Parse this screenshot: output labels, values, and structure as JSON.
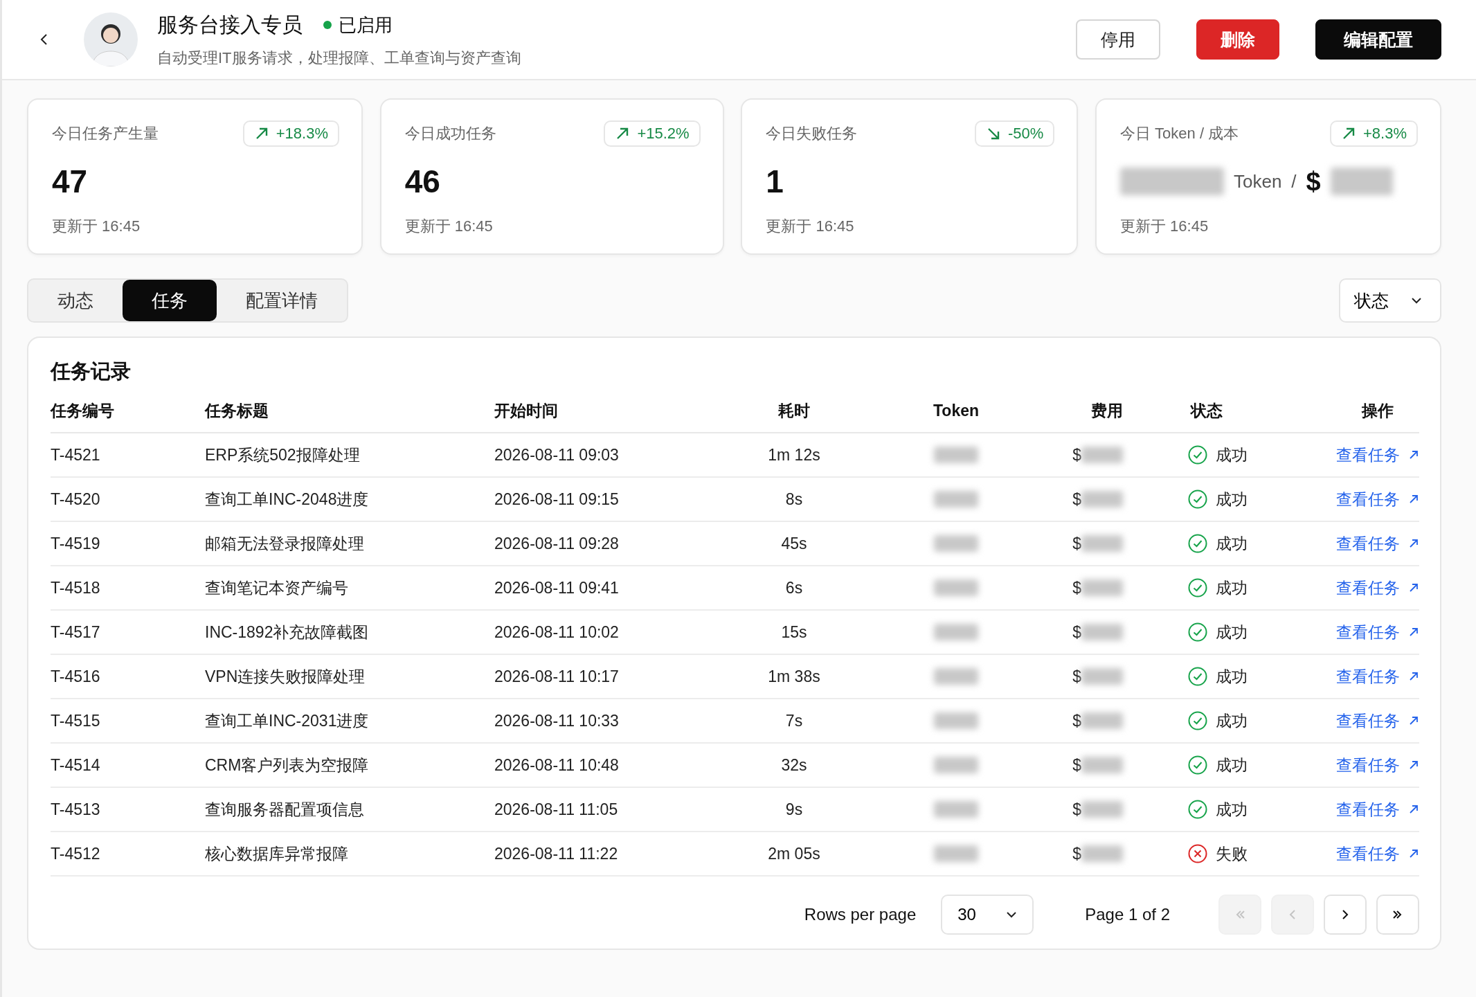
{
  "header": {
    "title": "服务台接入专员",
    "status": {
      "label": "已启用",
      "on": true
    },
    "subtitle": "自动受理IT服务请求，处理报障、工单查询与资产查询",
    "buttons": [
      {
        "label": "停用",
        "kind": "outline"
      },
      {
        "label": "删除",
        "kind": "danger"
      },
      {
        "label": "编辑配置",
        "kind": "primary"
      }
    ]
  },
  "stats": [
    {
      "kind": "number",
      "label": "今日任务产生量",
      "trend": {
        "rising": true,
        "text": "+18.3%"
      },
      "value": "47",
      "updated": "更新于  16:45"
    },
    {
      "kind": "number",
      "label": "今日成功任务",
      "trend": {
        "rising": true,
        "text": "+15.2%"
      },
      "value": "46",
      "updated": "更新于  16:45"
    },
    {
      "kind": "number",
      "label": "今日失败任务",
      "trend": {
        "rising": false,
        "text": "-50%"
      },
      "value": "1",
      "updated": "更新于  16:45"
    },
    {
      "kind": "token",
      "label": "今日 Token  / 成本",
      "trend": {
        "rising": true,
        "text": "+8.3%"
      },
      "token_unit": "Token",
      "separator": "/",
      "currency": "$",
      "updated": "更新于  16:45"
    }
  ],
  "tabs": [
    {
      "label": "动态",
      "selected": false
    },
    {
      "label": "任务",
      "selected": true
    },
    {
      "label": "配置详情",
      "selected": false
    }
  ],
  "filter": {
    "label": "状态"
  },
  "table": {
    "title": "任务记录",
    "columns": [
      "任务编号",
      "任务标题",
      "开始时间",
      "耗时",
      "Token",
      "费用",
      "状态",
      "操作"
    ],
    "rows": [
      {
        "id": "T-4521",
        "title": "ERP系统502报障处理",
        "start": "2026-08-11 09:03",
        "duration": "1m 12s",
        "cost_prefix": "$",
        "status": {
          "kind": "success",
          "label": "成功"
        },
        "action": "查看任务"
      },
      {
        "id": "T-4520",
        "title": "查询工单INC-2048进度",
        "start": "2026-08-11 09:15",
        "duration": "8s",
        "cost_prefix": "$",
        "status": {
          "kind": "success",
          "label": "成功"
        },
        "action": "查看任务"
      },
      {
        "id": "T-4519",
        "title": "邮箱无法登录报障处理",
        "start": "2026-08-11 09:28",
        "duration": "45s",
        "cost_prefix": "$",
        "status": {
          "kind": "success",
          "label": "成功"
        },
        "action": "查看任务"
      },
      {
        "id": "T-4518",
        "title": "查询笔记本资产编号",
        "start": "2026-08-11 09:41",
        "duration": "6s",
        "cost_prefix": "$",
        "status": {
          "kind": "success",
          "label": "成功"
        },
        "action": "查看任务"
      },
      {
        "id": "T-4517",
        "title": "INC-1892补充故障截图",
        "start": "2026-08-11 10:02",
        "duration": "15s",
        "cost_prefix": "$",
        "status": {
          "kind": "success",
          "label": "成功"
        },
        "action": "查看任务"
      },
      {
        "id": "T-4516",
        "title": "VPN连接失败报障处理",
        "start": "2026-08-11 10:17",
        "duration": "1m 38s",
        "cost_prefix": "$",
        "status": {
          "kind": "success",
          "label": "成功"
        },
        "action": "查看任务"
      },
      {
        "id": "T-4515",
        "title": "查询工单INC-2031进度",
        "start": "2026-08-11 10:33",
        "duration": "7s",
        "cost_prefix": "$",
        "status": {
          "kind": "success",
          "label": "成功"
        },
        "action": "查看任务"
      },
      {
        "id": "T-4514",
        "title": "CRM客户列表为空报障",
        "start": "2026-08-11 10:48",
        "duration": "32s",
        "cost_prefix": "$",
        "status": {
          "kind": "success",
          "label": "成功"
        },
        "action": "查看任务"
      },
      {
        "id": "T-4513",
        "title": "查询服务器配置项信息",
        "start": "2026-08-11 11:05",
        "duration": "9s",
        "cost_prefix": "$",
        "status": {
          "kind": "success",
          "label": "成功"
        },
        "action": "查看任务"
      },
      {
        "id": "T-4512",
        "title": "核心数据库异常报障",
        "start": "2026-08-11 11:22",
        "duration": "2m 05s",
        "cost_prefix": "$",
        "status": {
          "kind": "failed",
          "label": "失败"
        },
        "action": "查看任务"
      }
    ]
  },
  "pagination": {
    "rows_label": "Rows per page",
    "rows_value": "30",
    "page_text": "Page 1 of 2",
    "buttons": [
      {
        "kind": "first",
        "disabled": true
      },
      {
        "kind": "prev",
        "disabled": true
      },
      {
        "kind": "next",
        "disabled": false
      },
      {
        "kind": "last",
        "disabled": false
      }
    ]
  }
}
